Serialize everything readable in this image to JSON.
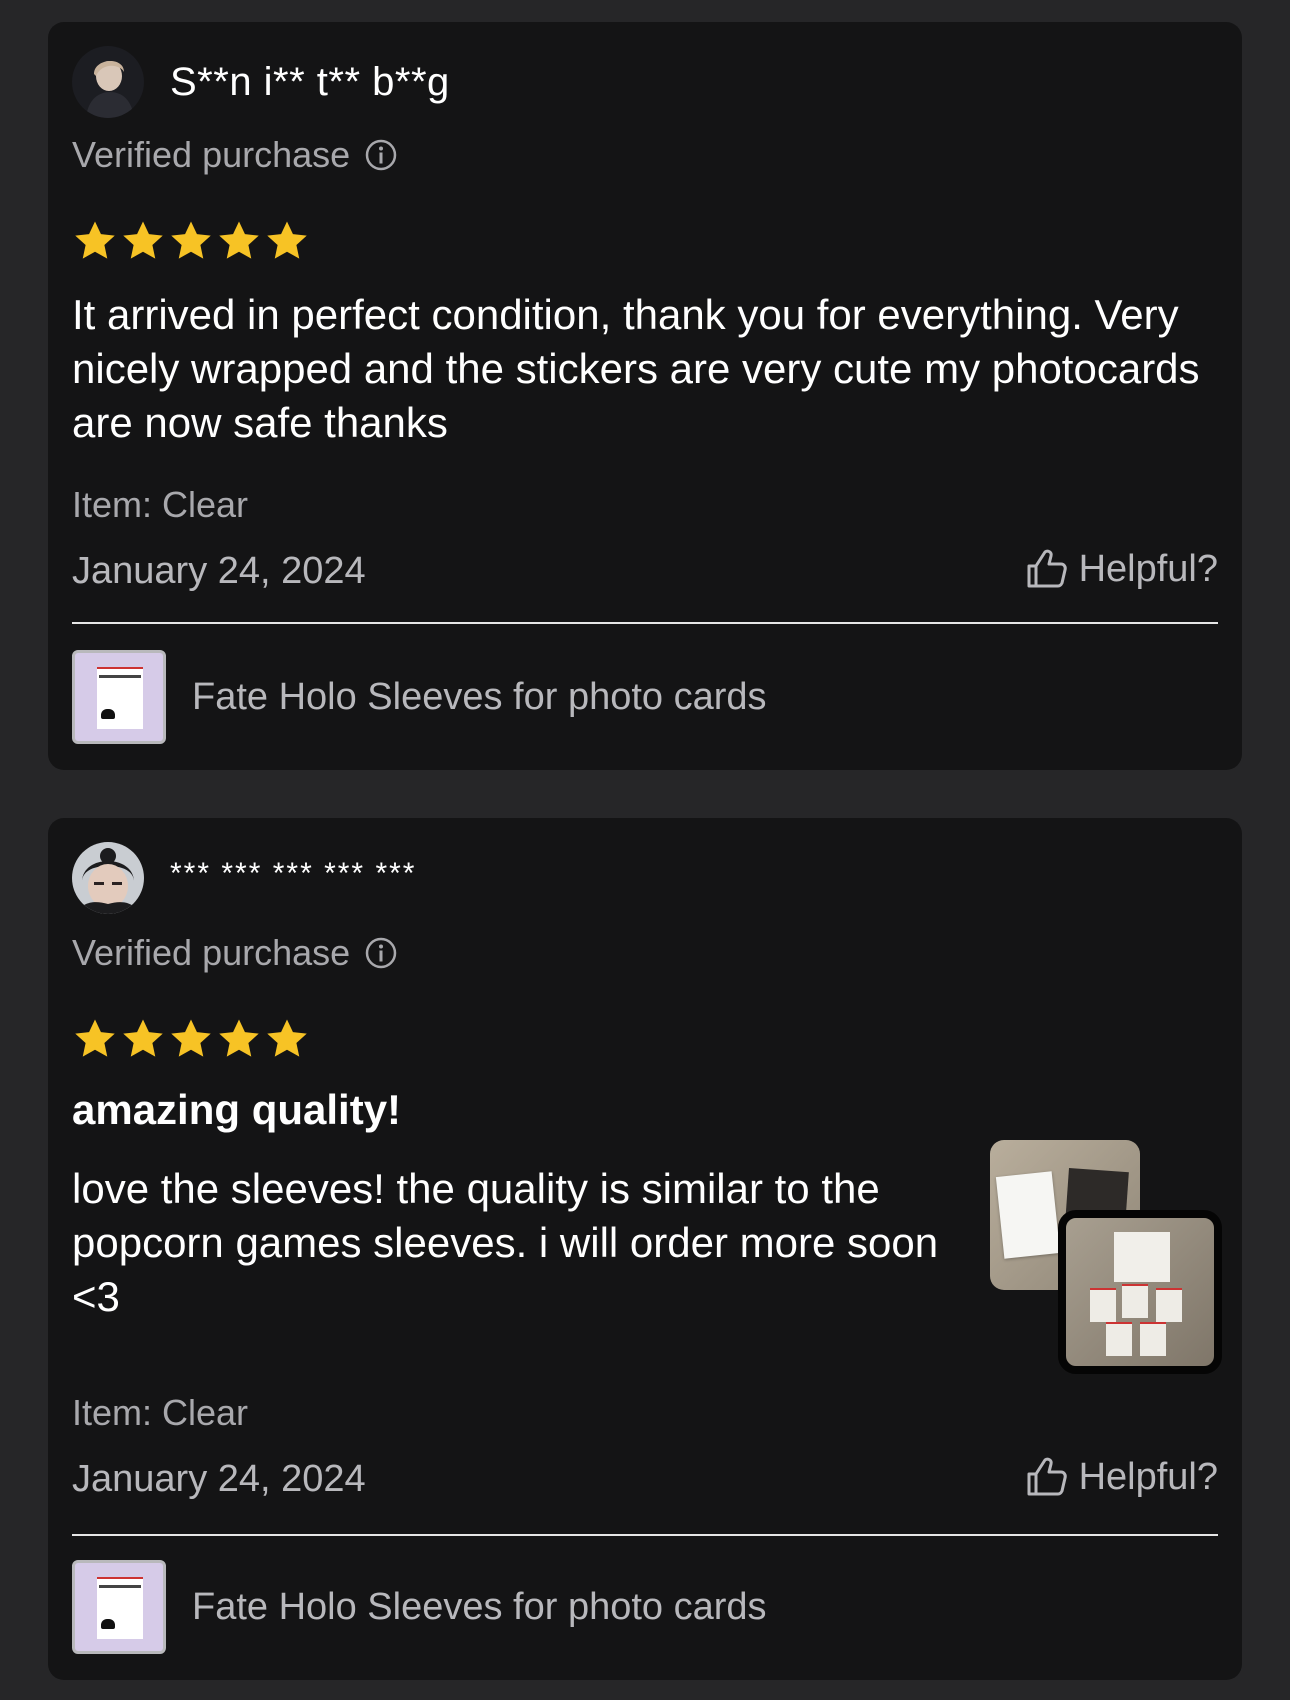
{
  "reviews": [
    {
      "reviewer": "S**n i** t** b**g",
      "verified_label": "Verified purchase",
      "rating": 5,
      "rating_max": 5,
      "title": "",
      "text": "It arrived in perfect condition, thank you for everything. Very nicely wrapped and the stickers are very cute my photocards are now safe thanks",
      "item": "Item: Clear",
      "date": "January 24, 2024",
      "helpful_label": "Helpful?",
      "product_name": "Fate Holo Sleeves for photo cards"
    },
    {
      "reviewer": "*** *** *** *** ***",
      "verified_label": "Verified purchase",
      "rating": 5,
      "rating_max": 5,
      "title": "amazing quality!",
      "text": "love the sleeves! the quality is similar to the popcorn games sleeves. i will order more soon <3",
      "item": "Item: Clear",
      "date": "January 24, 2024",
      "helpful_label": "Helpful?",
      "product_name": "Fate Holo Sleeves for photo cards"
    }
  ],
  "colors": {
    "background": "#262628",
    "card": "#141415",
    "star": "#f7c325",
    "muted_text": "#a8a8ac",
    "product_thumb_bg": "#d6cbe8"
  },
  "icons": [
    "info-icon",
    "star-icon",
    "thumbs-up-icon"
  ]
}
